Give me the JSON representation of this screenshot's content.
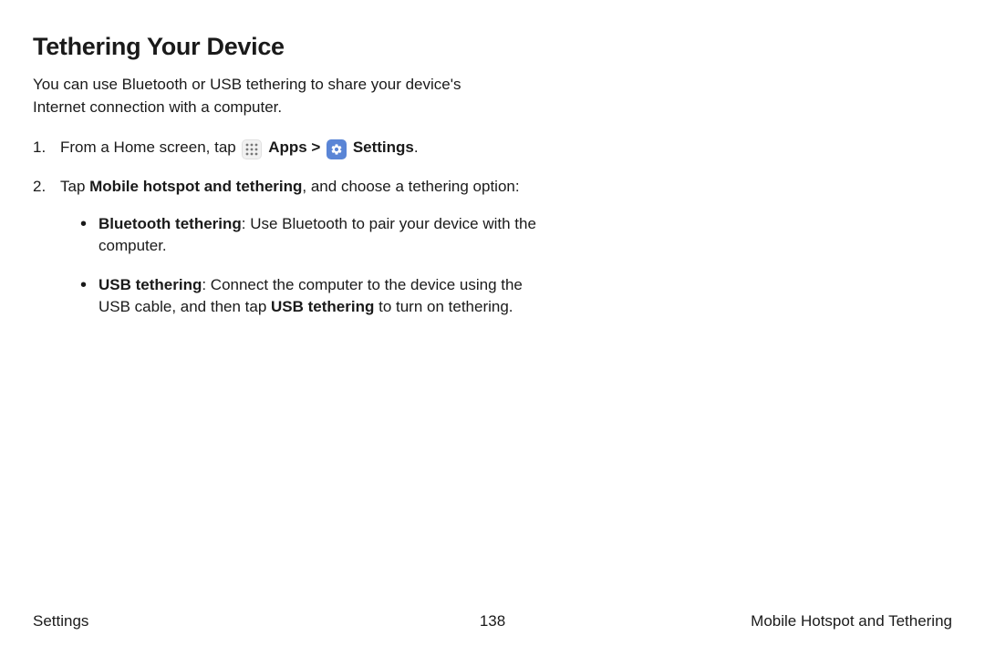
{
  "heading": "Tethering Your Device",
  "intro": "You can use Bluetooth or USB tethering to share your device's Internet connection with a computer.",
  "step1": {
    "prefix": "From a Home screen, tap ",
    "apps": "Apps",
    "separator": " > ",
    "settings": "Settings",
    "suffix": "."
  },
  "step2": {
    "prefix": "Tap ",
    "bold1": "Mobile hotspot and tethering",
    "rest": ", and choose a tethering option:"
  },
  "bullet1": {
    "bold": "Bluetooth tethering",
    "rest": ": Use Bluetooth to pair your device with the computer."
  },
  "bullet2": {
    "bold1": "USB tethering",
    "part1": ": Connect the computer to the device using the USB cable, and then tap ",
    "bold2": "USB tethering",
    "part2": " to turn on tethering."
  },
  "footer": {
    "left": "Settings",
    "center": "138",
    "right": "Mobile Hotspot and Tethering"
  }
}
